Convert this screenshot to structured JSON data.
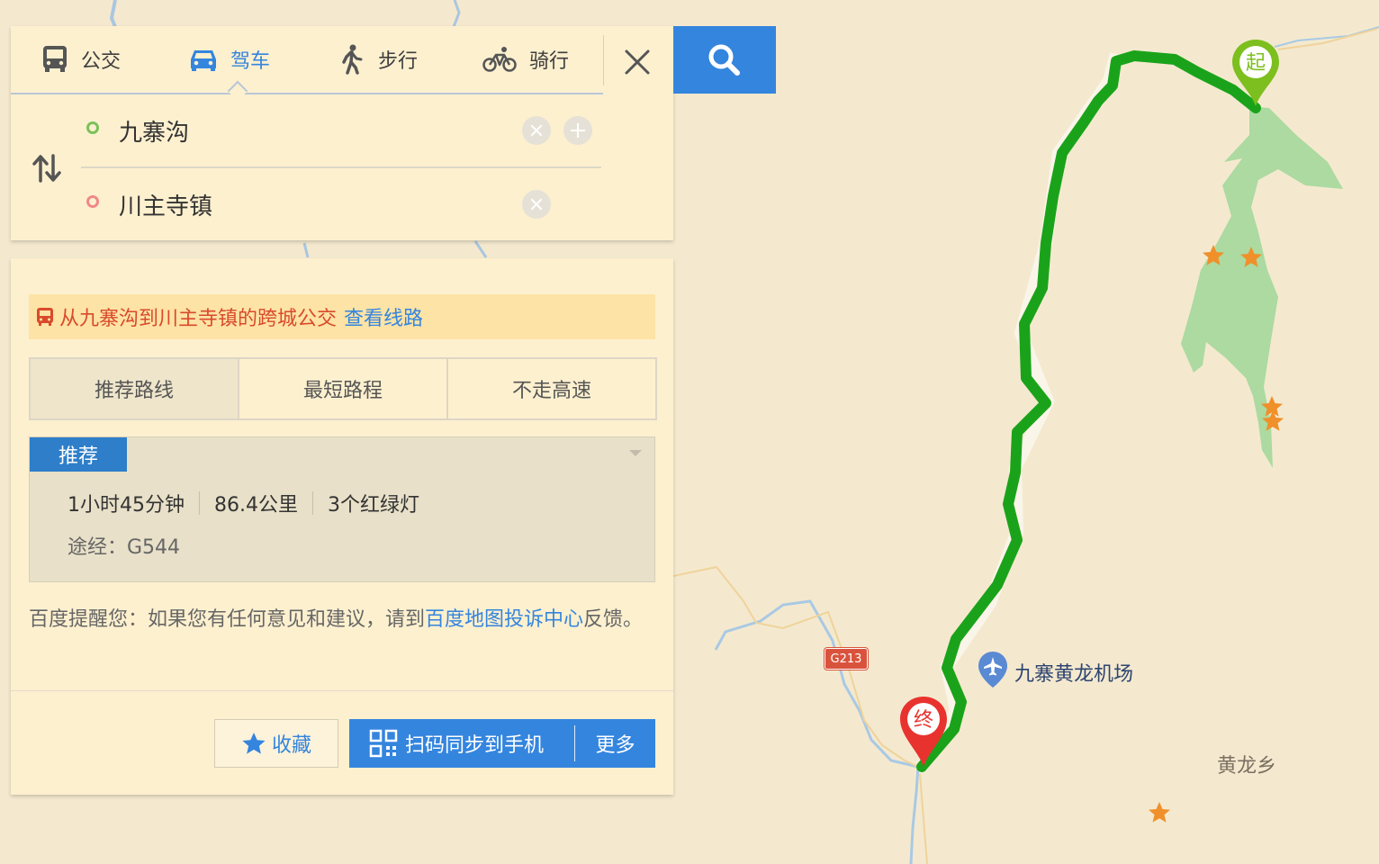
{
  "transport_tabs": [
    {
      "label": "公交",
      "icon": "bus-icon",
      "active": false
    },
    {
      "label": "驾车",
      "icon": "car-icon",
      "active": true
    },
    {
      "label": "步行",
      "icon": "walk-icon",
      "active": false
    },
    {
      "label": "骑行",
      "icon": "bike-icon",
      "active": false
    }
  ],
  "route": {
    "start": "九寨沟",
    "end": "川主寺镇"
  },
  "bus_banner": {
    "text": "从九寨沟到川主寺镇的跨城公交",
    "link": "查看线路"
  },
  "preference_tabs": [
    {
      "label": "推荐路线",
      "active": true
    },
    {
      "label": "最短路程",
      "active": false
    },
    {
      "label": "不走高速",
      "active": false
    }
  ],
  "plan": {
    "badge": "推荐",
    "duration": "1小时45分钟",
    "distance": "86.4公里",
    "traffic_lights": "3个红绿灯",
    "via": "途经：G544"
  },
  "tip": {
    "prefix": "百度提醒您：如果您有任何意见和建议，请到",
    "link": "百度地图投诉中心",
    "suffix": "反馈。"
  },
  "actions": {
    "favorite": "收藏",
    "sync": "扫码同步到手机",
    "more": "更多"
  },
  "map": {
    "start_marker": "起",
    "end_marker": "终",
    "airport": "九寨黄龙机场",
    "town": "黄龙乡",
    "road_shield": "G213"
  },
  "colors": {
    "accent": "#3485de",
    "route": "#1aa31a",
    "start_pin": "#7cbf1e",
    "end_pin": "#e8322e",
    "panel": "#fdf0cf"
  }
}
